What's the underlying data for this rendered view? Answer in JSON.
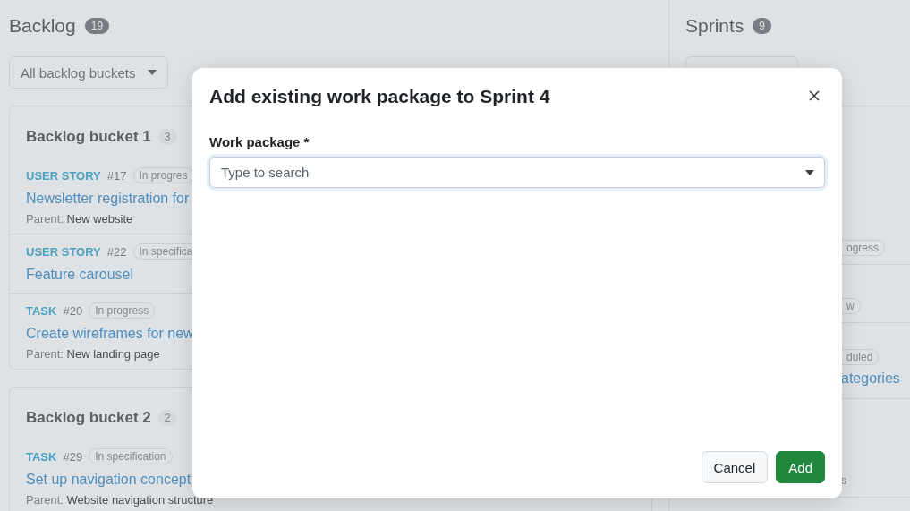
{
  "backlog": {
    "title": "Backlog",
    "count": "19",
    "filter": "All backlog buckets",
    "buckets": [
      {
        "title": "Backlog bucket 1",
        "count": "3",
        "items": [
          {
            "type": "USER STORY",
            "id": "#17",
            "status": "In progres",
            "title": "Newsletter registration for",
            "parent_label": "Parent:",
            "parent": "New website"
          },
          {
            "type": "USER STORY",
            "id": "#22",
            "status": "In specifica",
            "title": "Feature carousel"
          },
          {
            "type": "TASK",
            "id": "#20",
            "status": "In progress",
            "title": "Create wireframes for new",
            "parent_label": "Parent:",
            "parent": "New landing page"
          }
        ]
      },
      {
        "title": "Backlog bucket 2",
        "count": "2",
        "items": [
          {
            "type": "TASK",
            "id": "#29",
            "status": "In specification",
            "title": "Set up navigation concept",
            "parent_label": "Parent:",
            "parent": "Website navigation structure"
          }
        ]
      }
    ]
  },
  "sprints": {
    "title": "Sprints",
    "count": "9",
    "rows": [
      {
        "kind": "pill",
        "text": "ogress"
      },
      {
        "kind": "pill",
        "text": "w"
      },
      {
        "kind": "pill-title",
        "text": "duled",
        "title": "ategories"
      },
      {
        "kind": "tail",
        "text": "s"
      }
    ]
  },
  "dialog": {
    "title": "Add existing work package to Sprint 4",
    "field_label": "Work package *",
    "placeholder": "Type to search",
    "cancel": "Cancel",
    "submit": "Add"
  }
}
